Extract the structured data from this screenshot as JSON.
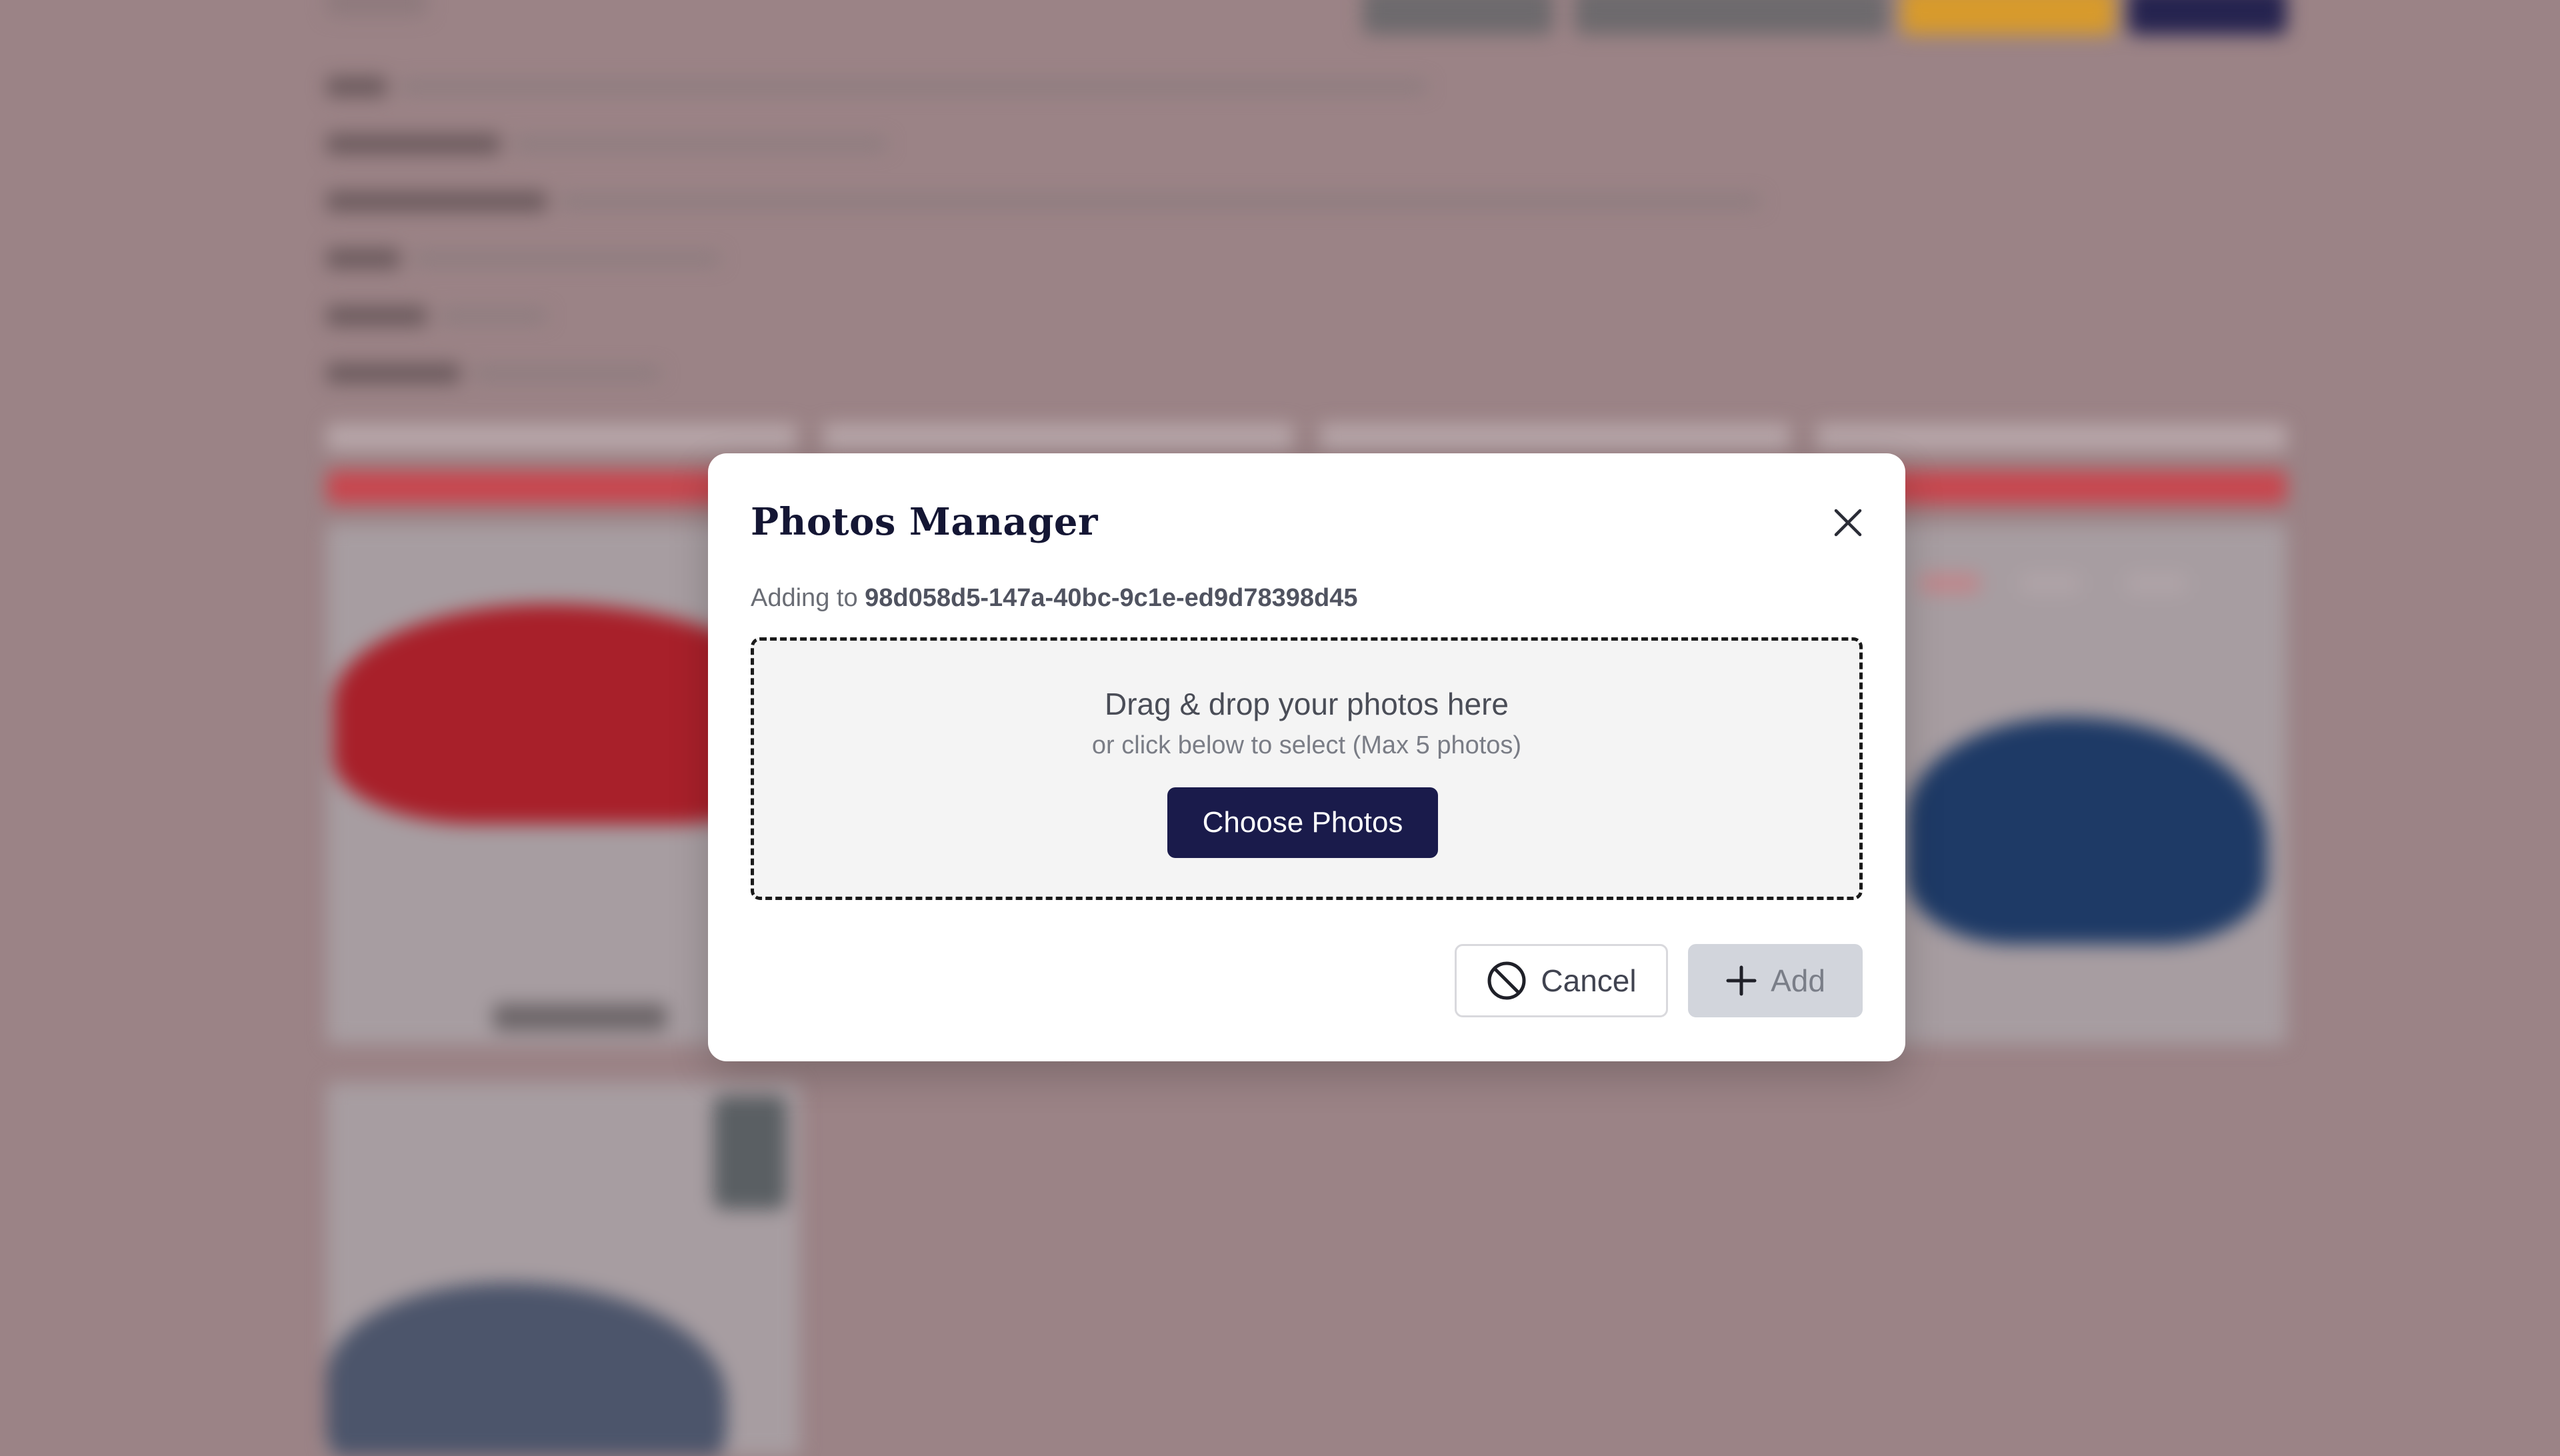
{
  "modal": {
    "title": "Photos Manager",
    "subtitle_prefix": "Adding to",
    "target_id": "98d058d5-147a-40bc-9c1e-ed9d78398d45",
    "dropzone": {
      "primary_text": "Drag & drop your photos here",
      "secondary_text": "or click below to select (Max 5 photos)",
      "choose_button_label": "Choose Photos"
    },
    "cancel_label": "Cancel",
    "add_label": "Add"
  },
  "colors": {
    "overlay": "#9b8386",
    "primary_button": "#1a1b4b",
    "disabled_button": "#d2d5dc"
  },
  "icons": {
    "close": "close-icon",
    "cancel": "ban-icon",
    "add": "plus-icon"
  }
}
